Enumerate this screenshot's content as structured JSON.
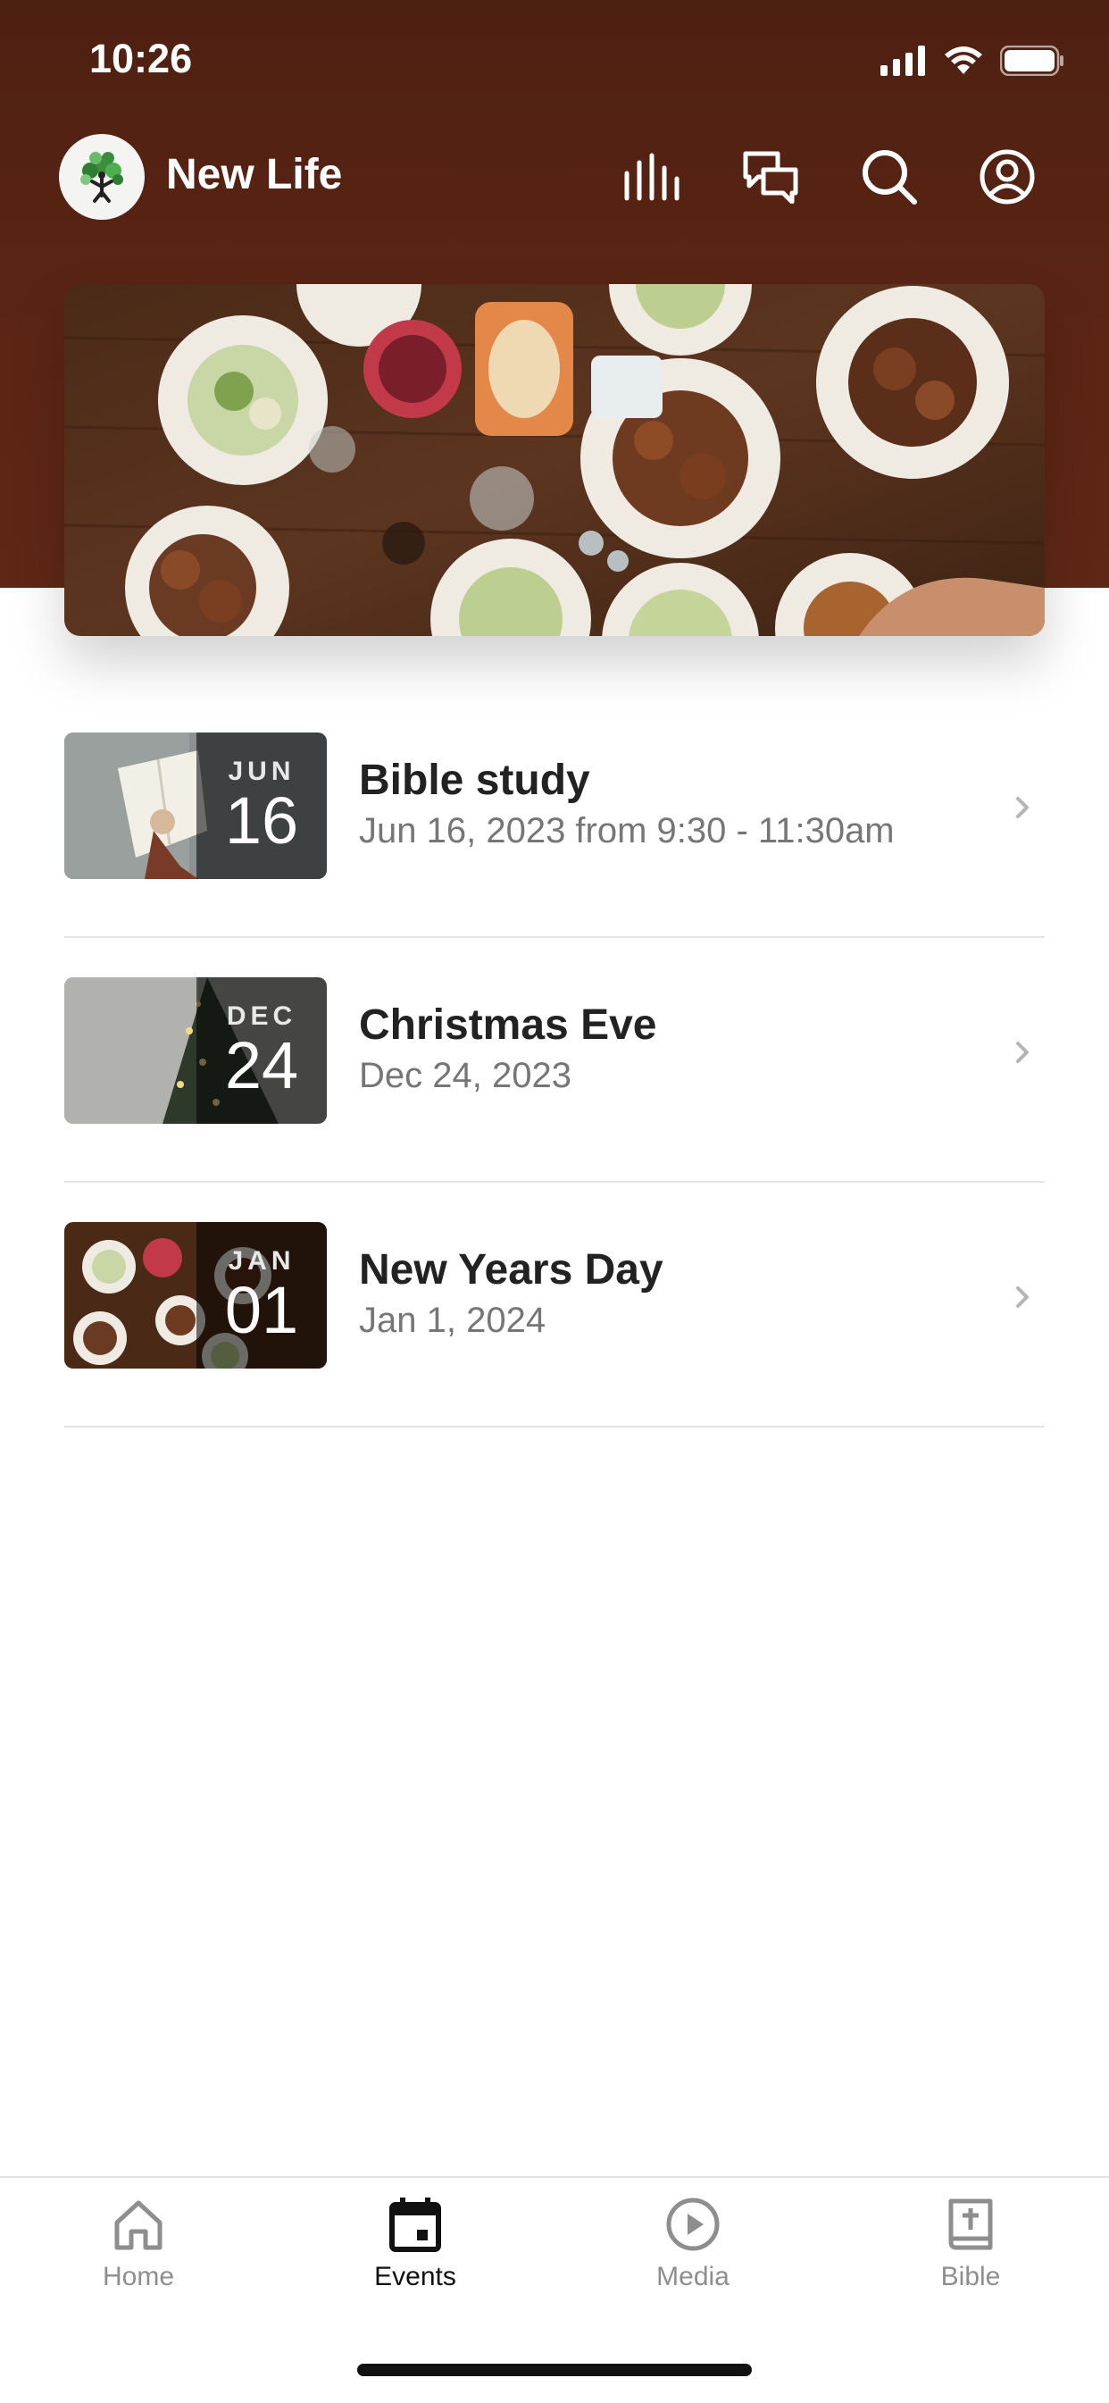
{
  "status": {
    "time": "10:26"
  },
  "header": {
    "app_name": "New Life"
  },
  "events": [
    {
      "month": "JUN",
      "day": "16",
      "title": "Bible study",
      "subtitle": "Jun 16, 2023 from 9:30 - 11:30am"
    },
    {
      "month": "DEC",
      "day": "24",
      "title": "Christmas Eve",
      "subtitle": "Dec 24, 2023"
    },
    {
      "month": "JAN",
      "day": "01",
      "title": "New Years Day",
      "subtitle": "Jan 1, 2024"
    }
  ],
  "tabs": [
    {
      "label": "Home",
      "icon": "home-icon",
      "active": false
    },
    {
      "label": "Events",
      "icon": "calendar-icon",
      "active": true
    },
    {
      "label": "Media",
      "icon": "play-icon",
      "active": false
    },
    {
      "label": "Bible",
      "icon": "bible-icon",
      "active": false
    }
  ],
  "colors": {
    "header": "#5a2414",
    "active_tab": "#111111",
    "inactive_tab": "#8e8e8e"
  }
}
